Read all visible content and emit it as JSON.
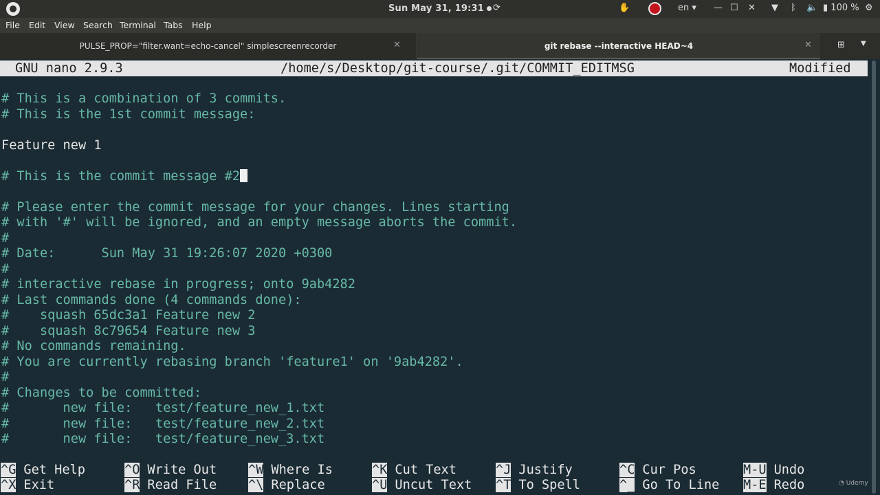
{
  "topbar": {
    "clock": "Sun May 31, 19:31",
    "language": "en",
    "battery": "100 %",
    "icons": [
      "ubuntu-logo-icon",
      "recording-dot-icon",
      "refresh-icon",
      "hand-icon",
      "record-icon",
      "minimize-icon",
      "maximize-icon",
      "close-icon",
      "wifi-icon",
      "bluetooth-icon",
      "volume-icon",
      "battery-icon",
      "gear-icon"
    ]
  },
  "menubar": {
    "items": [
      "File",
      "Edit",
      "View",
      "Search",
      "Terminal",
      "Tabs",
      "Help"
    ]
  },
  "tabs": [
    {
      "label": "PULSE_PROP=\"filter.want=echo-cancel\" simplescreenrecorder",
      "active": false
    },
    {
      "label": "git rebase --interactive HEAD~4",
      "active": true
    }
  ],
  "nano": {
    "version": "GNU nano 2.9.3",
    "path": "/home/s/Desktop/git-course/.git/COMMIT_EDITMSG",
    "status": "Modified",
    "lines": [
      "# This is a combination of 3 commits.",
      "# This is the 1st commit message:",
      "",
      "Feature new 1",
      "",
      "# This is the commit message #2",
      "",
      "# Please enter the commit message for your changes. Lines starting",
      "# with '#' will be ignored, and an empty message aborts the commit.",
      "#",
      "# Date:      Sun May 31 19:26:07 2020 +0300",
      "#",
      "# interactive rebase in progress; onto 9ab4282",
      "# Last commands done (4 commands done):",
      "#    squash 65dc3a1 Feature new 2",
      "#    squash 8c79654 Feature new 3",
      "# No commands remaining.",
      "# You are currently rebasing branch 'feature1' on '9ab4282'.",
      "#",
      "# Changes to be committed:",
      "#       new file:   test/feature_new_1.txt",
      "#       new file:   test/feature_new_2.txt",
      "#       new file:   test/feature_new_3.txt"
    ],
    "shortcuts_row1": [
      {
        "key": "^G",
        "label": "Get Help"
      },
      {
        "key": "^O",
        "label": "Write Out"
      },
      {
        "key": "^W",
        "label": "Where Is"
      },
      {
        "key": "^K",
        "label": "Cut Text"
      },
      {
        "key": "^J",
        "label": "Justify"
      },
      {
        "key": "^C",
        "label": "Cur Pos"
      },
      {
        "key": "M-U",
        "label": "Undo"
      }
    ],
    "shortcuts_row2": [
      {
        "key": "^X",
        "label": "Exit"
      },
      {
        "key": "^R",
        "label": "Read File"
      },
      {
        "key": "^\\",
        "label": "Replace"
      },
      {
        "key": "^U",
        "label": "Uncut Text"
      },
      {
        "key": "^T",
        "label": "To Spell"
      },
      {
        "key": "^_",
        "label": "Go To Line"
      },
      {
        "key": "M-E",
        "label": "Redo"
      }
    ]
  },
  "watermark": "Udemy"
}
